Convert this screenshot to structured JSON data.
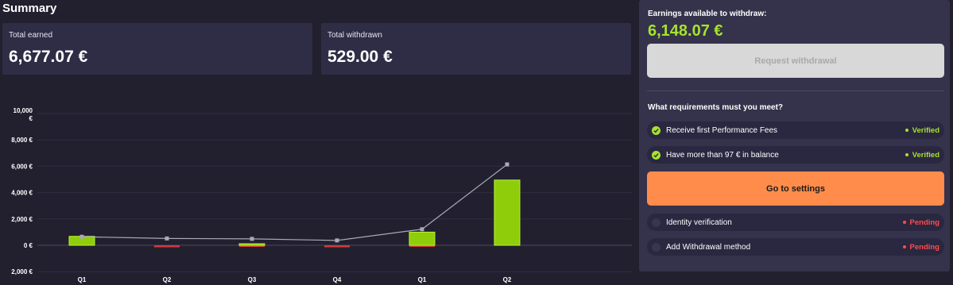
{
  "summary": {
    "title": "Summary",
    "total_earned": {
      "label": "Total earned",
      "value": "6,677.07 €"
    },
    "total_withdrawn": {
      "label": "Total withdrawn",
      "value": "529.00 €"
    }
  },
  "withdraw_panel": {
    "available_label": "Earnings available to withdraw:",
    "available_value": "6,148.07 €",
    "request_button": "Request withdrawal",
    "requirements_heading": "What requirements must you meet?",
    "requirements": [
      {
        "label": "Receive first Performance Fees",
        "status": "Verified",
        "state": "ok"
      },
      {
        "label": "Have more than 97 € in balance",
        "status": "Verified",
        "state": "ok"
      }
    ],
    "settings_button": "Go to settings",
    "pending_requirements": [
      {
        "label": "Identity verification",
        "status": "Pending",
        "state": "pending"
      },
      {
        "label": "Add Withdrawal method",
        "status": "Pending",
        "state": "pending"
      }
    ]
  },
  "colors": {
    "accent_green": "#a6e22e",
    "bar_green": "#8fcc0a",
    "bar_red": "#d43a3a",
    "line_gray": "#a9a9b8",
    "settings_orange": "#ff8c4a",
    "pending_red": "#ff4b4b"
  },
  "chart_data": {
    "type": "bar",
    "categories": [
      "Q1",
      "Q2",
      "Q3",
      "Q4",
      "Q1",
      "Q2"
    ],
    "ylim": [
      -2000,
      10000
    ],
    "yticks": [
      -2000,
      0,
      2000,
      4000,
      6000,
      8000,
      10000
    ],
    "ytick_labels": [
      "2,000 €",
      "0 €",
      "2,000 €",
      "4,000 €",
      "6,000 €",
      "8,000 €",
      "10,000 €"
    ],
    "series": [
      {
        "type": "bar",
        "values": [
          680,
          0,
          120,
          0,
          1000,
          4950
        ]
      },
      {
        "type": "bar",
        "values": [
          0,
          -150,
          -60,
          -150,
          -80,
          0
        ]
      },
      {
        "type": "line",
        "values": [
          650,
          520,
          490,
          370,
          1220,
          6140
        ]
      }
    ],
    "grid": true
  }
}
